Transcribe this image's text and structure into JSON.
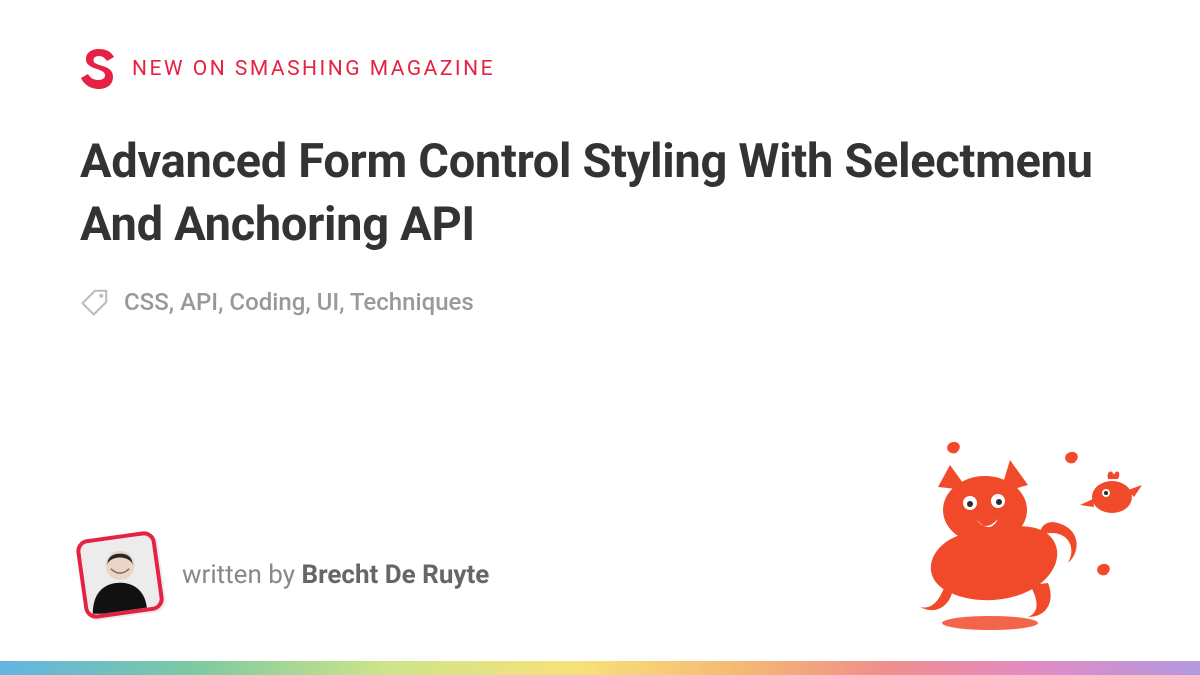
{
  "kicker": "NEW ON SMASHING MAGAZINE",
  "title": "Advanced Form Control Styling With Selectmenu And Anchoring API",
  "tags_line": "CSS, API, Coding, UI, Techniques",
  "byline_prefix": "written by ",
  "author": "Brecht De Ruyte",
  "colors": {
    "brand": "#e62143",
    "title": "#333333",
    "muted": "#999999"
  }
}
